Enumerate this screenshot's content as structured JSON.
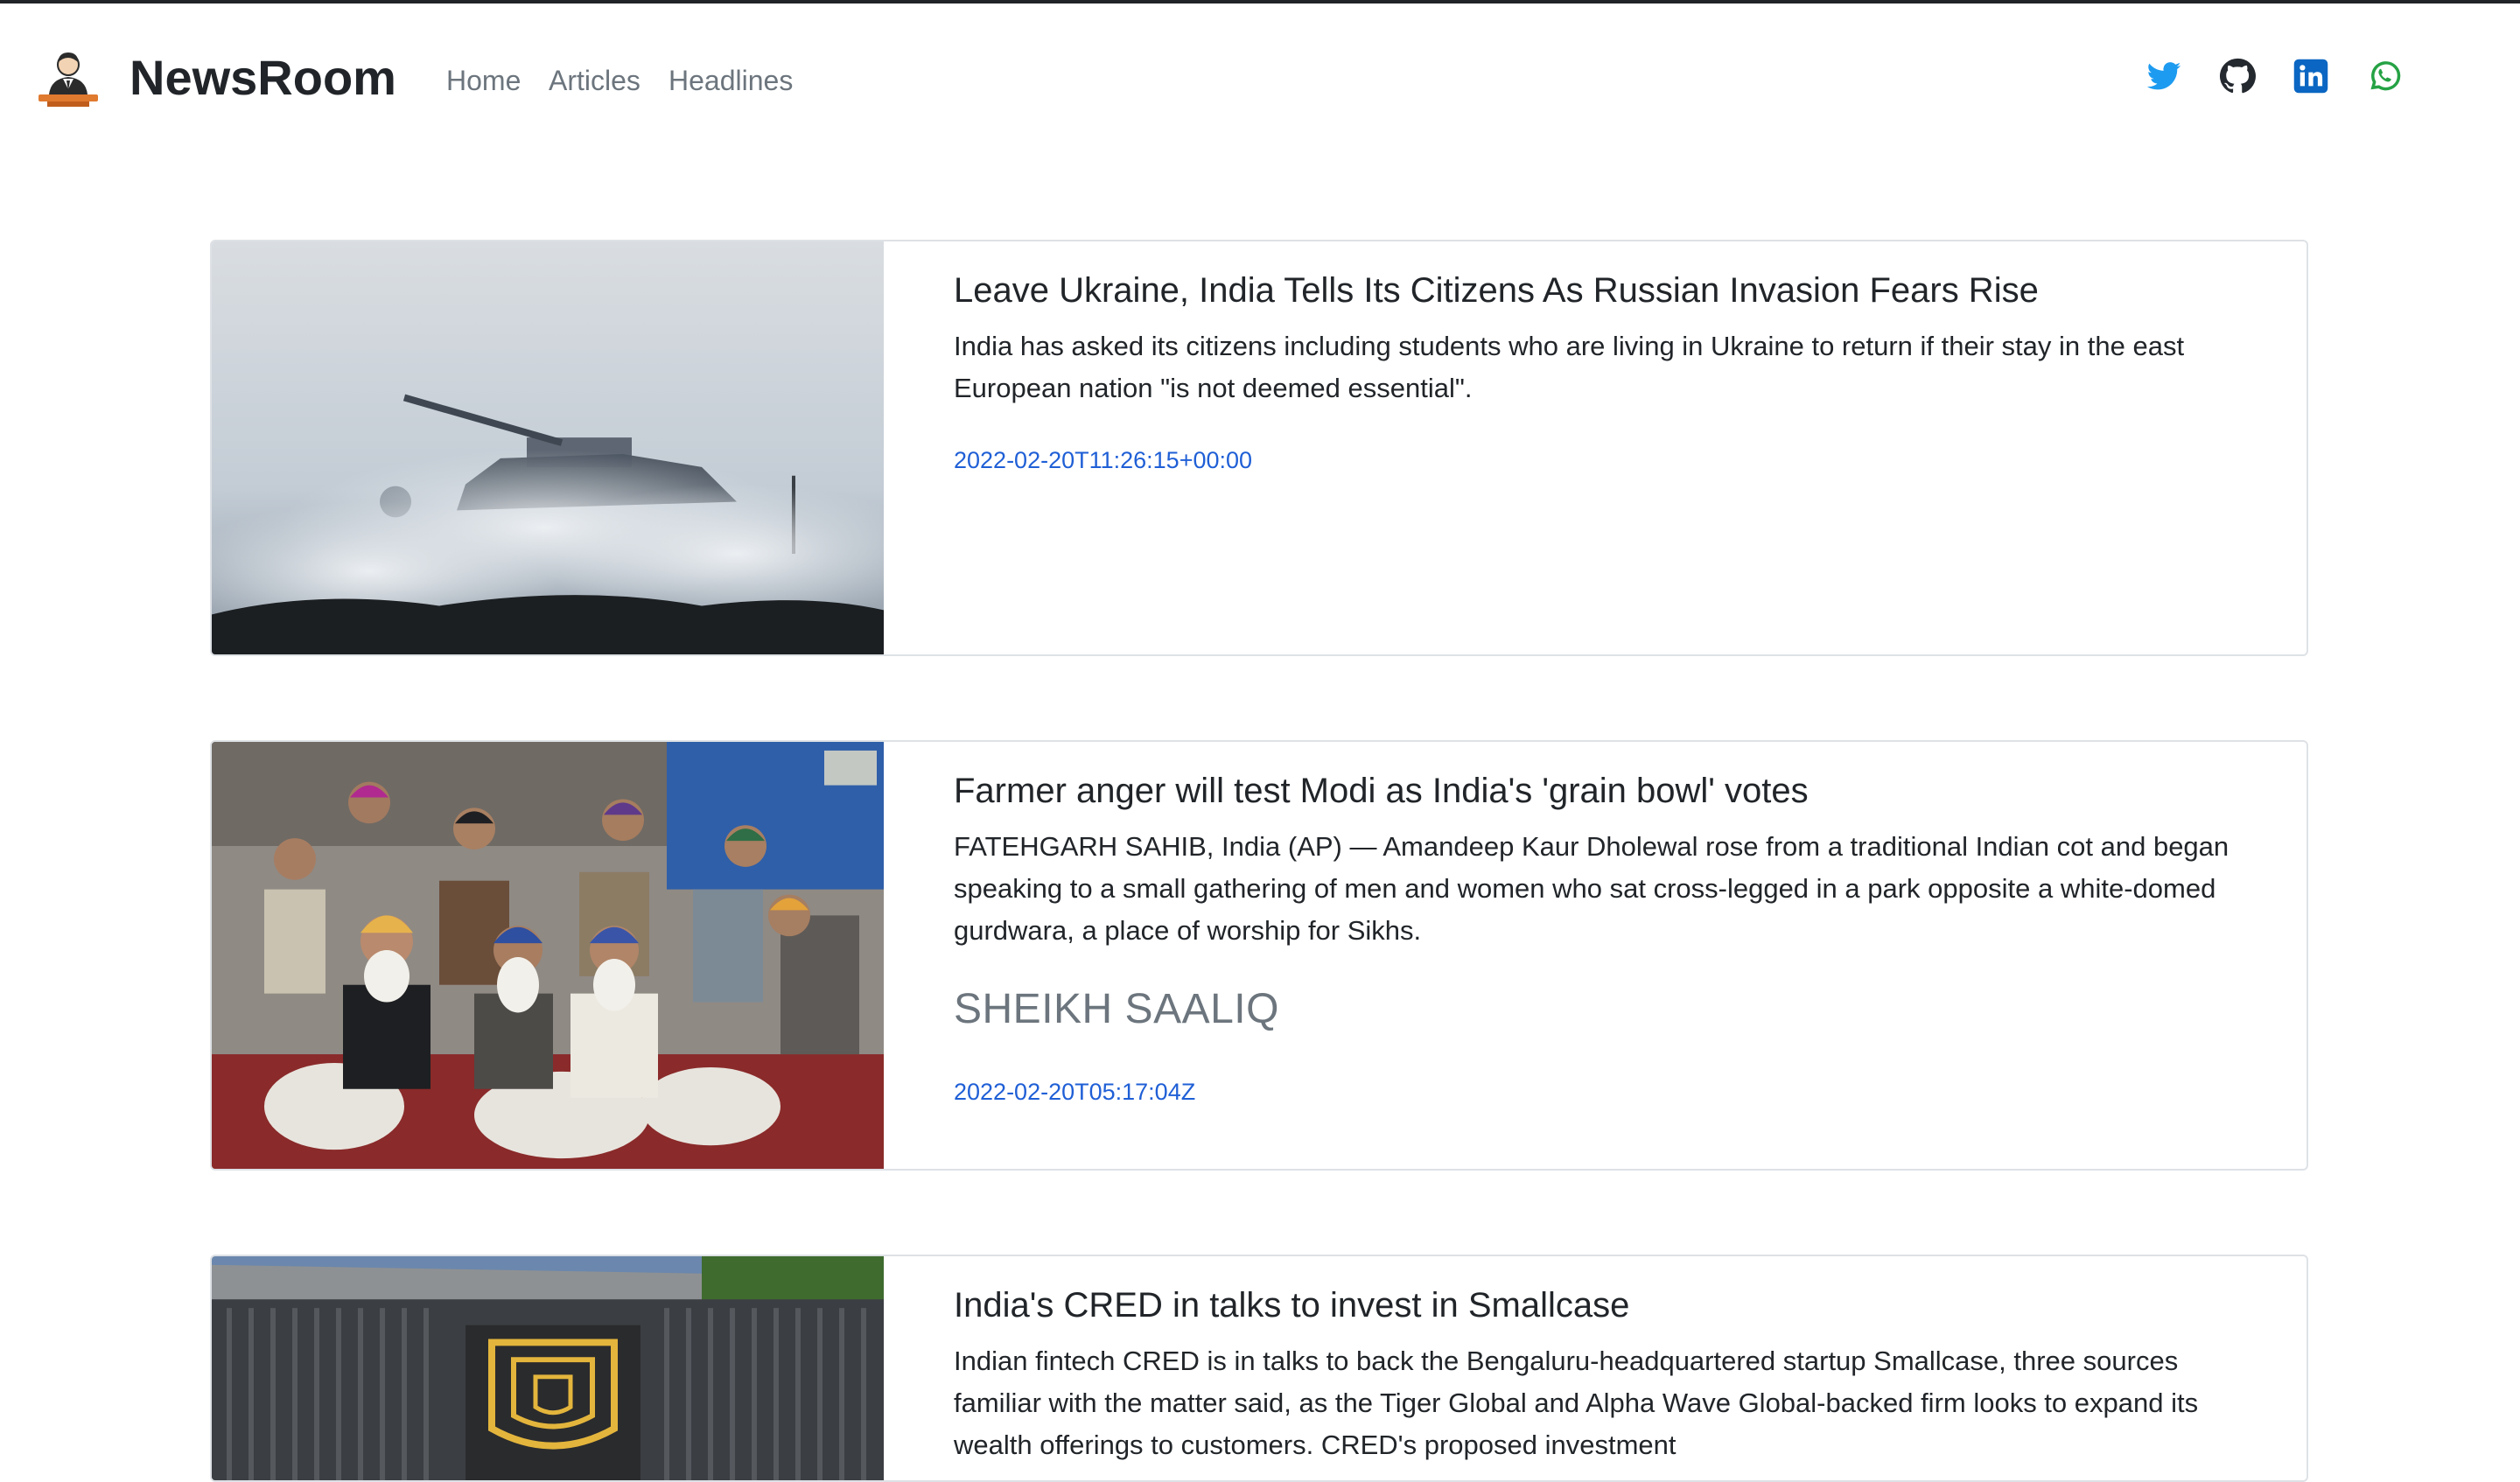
{
  "brand": {
    "name": "NewsRoom",
    "logo_icon": "news-anchor-icon"
  },
  "nav": {
    "items": [
      {
        "label": "Home"
      },
      {
        "label": "Articles"
      },
      {
        "label": "Headlines"
      }
    ]
  },
  "social": [
    {
      "icon": "twitter-icon",
      "color": "#1d9bf0"
    },
    {
      "icon": "github-icon",
      "color": "#24292f"
    },
    {
      "icon": "linkedin-icon",
      "color": "#0a66c2"
    },
    {
      "icon": "whatsapp-icon",
      "color": "#25a244"
    }
  ],
  "articles": [
    {
      "title": "Leave Ukraine, India Tells Its Citizens As Russian Invasion Fears Rise",
      "description": "India has asked its citizens including students who are living in Ukraine to return if their stay in the east European nation \"is not deemed essential\".",
      "author": "",
      "date": "2022-02-20T11:26:15+00:00",
      "image": "tank-in-smoke-image"
    },
    {
      "title": "Farmer anger will test Modi as India's 'grain bowl' votes",
      "description": "FATEHGARH SAHIB, India (AP) — Amandeep Kaur Dholewal rose from a traditional Indian cot and began speaking to a small gathering of men and women who sat cross-legged in a park opposite a white-domed gurdwara, a place of worship for Sikhs.",
      "author": "SHEIKH SAALIQ",
      "date": "2022-02-20T05:17:04Z",
      "image": "sikh-farmers-sitting-image"
    },
    {
      "title": "India's CRED in talks to invest in Smallcase",
      "description": "Indian fintech CRED is in talks to back the Bengaluru-headquartered startup Smallcase, three sources familiar with the matter said, as the Tiger Global and Alpha Wave Global-backed firm looks to expand its wealth offerings to customers. CRED's proposed investment",
      "author": "",
      "date": "",
      "image": "cred-office-building-image"
    }
  ]
}
